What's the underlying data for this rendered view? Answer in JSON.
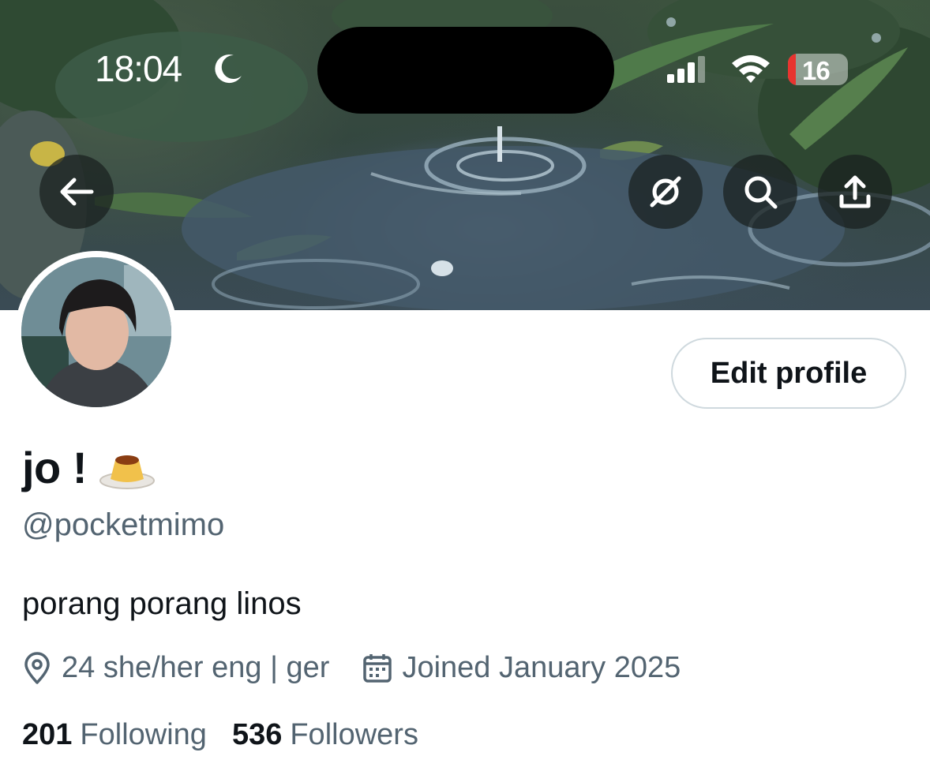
{
  "status_bar": {
    "time": "18:04",
    "battery_level": "16",
    "icons": [
      "moon-icon",
      "signal-icon",
      "wifi-icon",
      "battery-icon"
    ]
  },
  "nav": {
    "icons": [
      "back-arrow-icon",
      "mute-circle-icon",
      "search-icon",
      "share-icon"
    ]
  },
  "profile": {
    "name": "jo !",
    "handle": "@pocketmimo",
    "bio": "porang porang linos",
    "location": "24 she/her eng | ger",
    "joined": "Joined January 2025",
    "following_count": "201",
    "following_label": "Following",
    "followers_count": "536",
    "followers_label": "Followers",
    "edit_button_label": "Edit profile"
  },
  "colors": {
    "text_primary": "#0f1419",
    "text_secondary": "#536471",
    "button_border": "#cfd9de",
    "battery_low": "#e8342f"
  }
}
